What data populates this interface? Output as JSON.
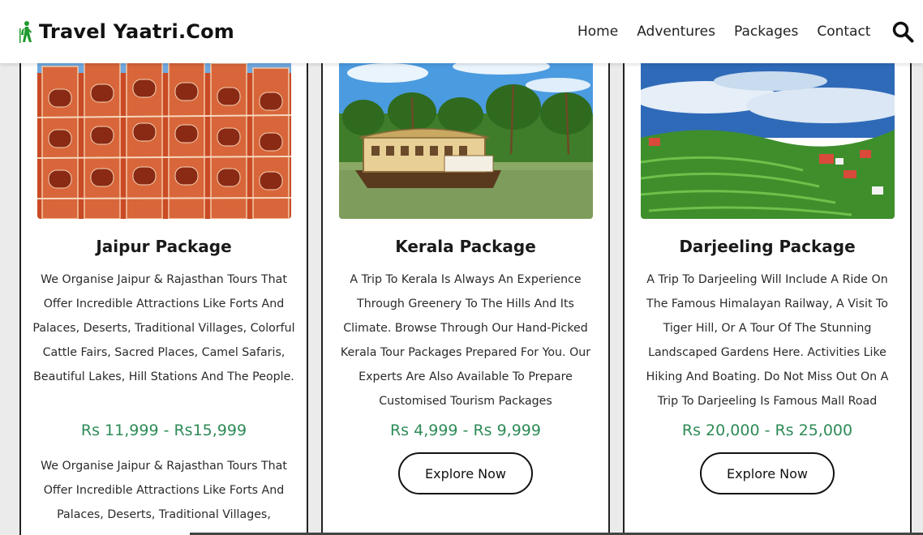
{
  "header": {
    "brand": "Travel Yaatri.Com",
    "brand_icon": "hiker-icon",
    "nav": [
      "Home",
      "Adventures",
      "Packages",
      "Contact"
    ],
    "search_icon": "search-icon"
  },
  "cards": [
    {
      "title": "Jaipur Package",
      "description": "We Organise Jaipur & Rajasthan Tours That Offer Incredible Attractions Like Forts And Palaces, Deserts, Traditional Villages, Colorful Cattle Fairs, Sacred Places, Camel Safaris, Beautiful Lakes, Hill Stations And The People.",
      "price": "Rs 11,999 - Rs15,999",
      "description_repeat": "We Organise Jaipur & Rajasthan Tours That Offer Incredible Attractions Like Forts And Palaces, Deserts, Traditional Villages,"
    },
    {
      "title": "Kerala Package",
      "description": "A Trip To Kerala Is Always An Experience Through Greenery To The Hills And Its Climate. Browse Through Our Hand-Picked Kerala Tour Packages Prepared For You. Our Experts Are Also Available To Prepare Customised Tourism Packages",
      "price": "Rs 4,999 - Rs 9,999",
      "button": "Explore Now"
    },
    {
      "title": "Darjeeling Package",
      "description": "A Trip To Darjeeling Will Include A Ride On The Famous Himalayan Railway, A Visit To Tiger Hill, Or A Tour Of The Stunning Landscaped Gardens Here. Activities Like Hiking And Boating. Do Not Miss Out On A Trip To Darjeeling Is Famous Mall Road",
      "price": "Rs 20,000 - Rs 25,000",
      "button": "Explore Now"
    }
  ],
  "colors": {
    "price": "#2e8b57",
    "brand_icon": "#1f9a2f"
  }
}
